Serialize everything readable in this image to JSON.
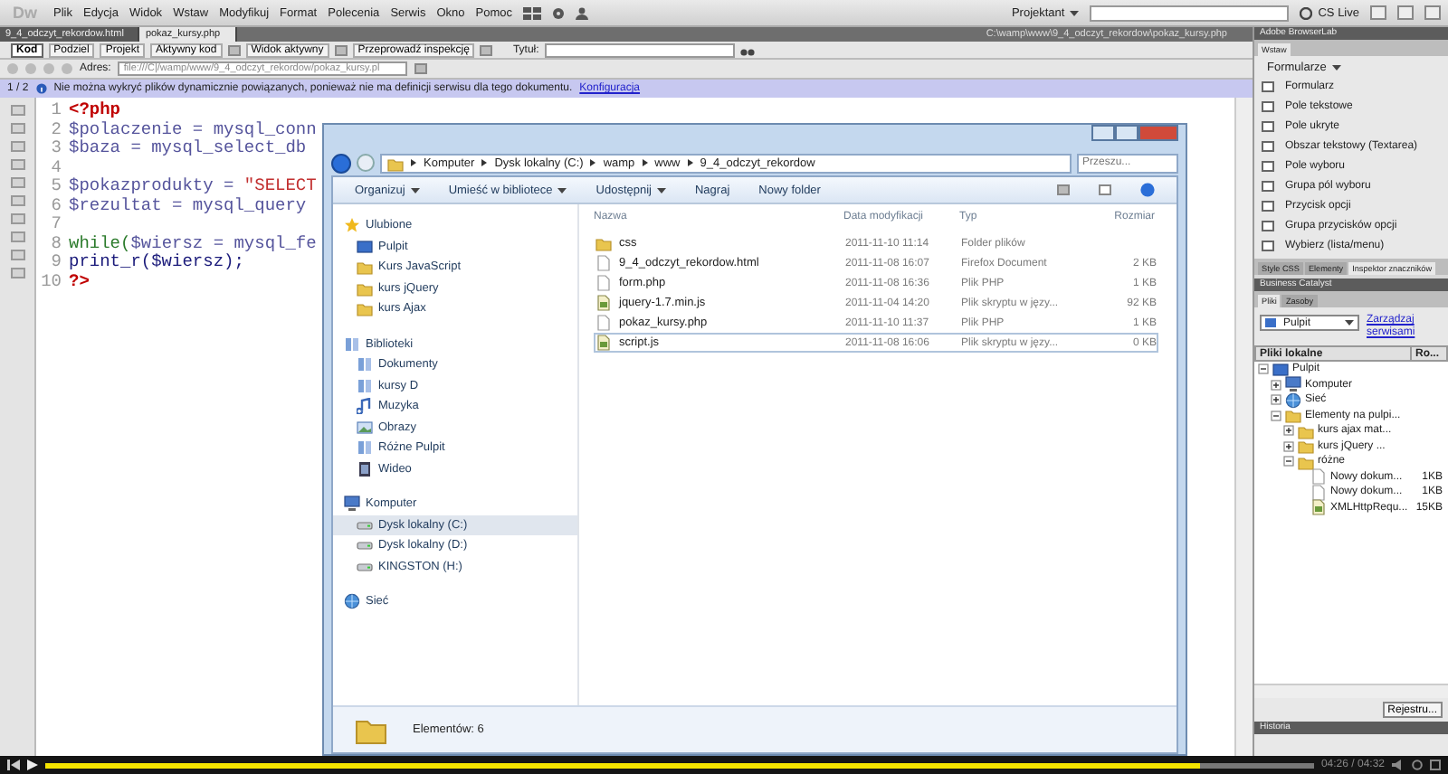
{
  "app": {
    "logo": "Dw",
    "menu": [
      "Plik",
      "Edycja",
      "Widok",
      "Wstaw",
      "Modyfikuj",
      "Format",
      "Polecenia",
      "Serwis",
      "Okno",
      "Pomoc"
    ],
    "workspace": "Projektant",
    "cs_live": "CS Live"
  },
  "document_tabs": [
    {
      "label": "9_4_odczyt_rekordow.html",
      "selected": false
    },
    {
      "label": "pokaz_kursy.php",
      "selected": true
    }
  ],
  "document_path": "C:\\wamp\\www\\9_4_odczyt_rekordow\\pokaz_kursy.php",
  "view_buttons": [
    {
      "label": "Kod",
      "selected": true
    },
    {
      "label": "Podziel",
      "selected": false
    },
    {
      "label": "Projekt",
      "selected": false
    }
  ],
  "toolbar_buttons": [
    "Aktywny kod",
    "Widok aktywny",
    "Przeprowadź inspekcję"
  ],
  "title_label": "Tytuł:",
  "address": {
    "label": "Adres:",
    "value": "file:///C|/wamp/www/9_4_odczyt_rekordow/pokaz_kursy.pl"
  },
  "info_bar": {
    "counter": "1 / 2",
    "message": "Nie można wykryć plików dynamicznie powiązanych, ponieważ nie ma definicji serwisu dla tego dokumentu.",
    "link": "Konfiguracja"
  },
  "code_lines": [
    {
      "number": "1",
      "tokens": [
        {
          "text": "<?php",
          "kind": "tag"
        }
      ]
    },
    {
      "number": "2",
      "tokens": [
        {
          "text": "$polaczenie = mysql_conn",
          "kind": "variable"
        }
      ]
    },
    {
      "number": "3",
      "tokens": [
        {
          "text": "$baza = mysql_select_db",
          "kind": "variable"
        }
      ]
    },
    {
      "number": "4"
    },
    {
      "number": "5",
      "tokens": [
        {
          "text": "$pokazprodukty = ",
          "kind": "variable"
        },
        {
          "text": "\"SELECT",
          "kind": "string"
        }
      ]
    },
    {
      "number": "6",
      "tokens": [
        {
          "text": "$rezultat = mysql_query",
          "kind": "variable"
        }
      ]
    },
    {
      "number": "7"
    },
    {
      "number": "8",
      "tokens": [
        {
          "text": "while(",
          "kind": "keyword"
        },
        {
          "text": "$wiersz = mysql_fe",
          "kind": "variable"
        }
      ]
    },
    {
      "number": "9",
      "tokens": [
        {
          "text": "print_r($wiersz);",
          "kind": "plain"
        }
      ]
    },
    {
      "number": "10",
      "tokens": [
        {
          "text": "?>",
          "kind": "tag"
        }
      ]
    }
  ],
  "explorer": {
    "breadcrumb": [
      "Komputer",
      "Dysk lokalny (C:)",
      "wamp",
      "www",
      "9_4_odczyt_rekordow"
    ],
    "search_placeholder": "Przeszu...",
    "toolbar": [
      {
        "label": "Organizuj",
        "dropdown": true
      },
      {
        "label": "Umieść w bibliotece",
        "dropdown": true
      },
      {
        "label": "Udostępnij",
        "dropdown": true
      },
      {
        "label": "Nagraj",
        "dropdown": false
      },
      {
        "label": "Nowy folder",
        "dropdown": false
      }
    ],
    "nav": [
      {
        "label": "Ulubione",
        "kind": "star",
        "selected": false,
        "items": [
          {
            "label": "Pulpit",
            "kind": "desktop",
            "selected": false
          },
          {
            "label": "Kurs JavaScript",
            "kind": "folder",
            "selected": false
          },
          {
            "label": "kurs jQuery",
            "kind": "folder",
            "selected": false
          },
          {
            "label": "kurs Ajax",
            "kind": "folder",
            "selected": false
          }
        ]
      },
      {
        "label": "Biblioteki",
        "kind": "library",
        "selected": false,
        "items": [
          {
            "label": "Dokumenty",
            "kind": "library",
            "selected": false
          },
          {
            "label": "kursy D",
            "kind": "library",
            "selected": false
          },
          {
            "label": "Muzyka",
            "kind": "music",
            "selected": false
          },
          {
            "label": "Obrazy",
            "kind": "picture",
            "selected": false
          },
          {
            "label": "Różne Pulpit",
            "kind": "library",
            "selected": false
          },
          {
            "label": "Wideo",
            "kind": "video",
            "selected": false
          }
        ]
      },
      {
        "label": "Komputer",
        "kind": "computer",
        "selected": false,
        "items": [
          {
            "label": "Dysk lokalny (C:)",
            "kind": "drive",
            "selected": true
          },
          {
            "label": "Dysk lokalny (D:)",
            "kind": "drive",
            "selected": false
          },
          {
            "label": "KINGSTON (H:)",
            "kind": "drive",
            "selected": false
          }
        ]
      },
      {
        "label": "Sieć",
        "kind": "network",
        "selected": false
      }
    ],
    "columns": [
      "Nazwa",
      "Data modyfikacji",
      "Typ",
      "Rozmiar"
    ],
    "files": [
      {
        "name": "css",
        "date": "2011-11-10 11:14",
        "type": "Folder plików",
        "kind": "folder",
        "focused": false
      },
      {
        "name": "9_4_odczyt_rekordow.html",
        "date": "2011-11-08 16:07",
        "type": "Firefox Document",
        "size": "2 KB",
        "kind": "file",
        "focused": false
      },
      {
        "name": "form.php",
        "date": "2011-11-08 16:36",
        "type": "Plik PHP",
        "size": "1 KB",
        "kind": "file",
        "focused": false
      },
      {
        "name": "jquery-1.7.min.js",
        "date": "2011-11-04 14:20",
        "type": "Plik skryptu w języ...",
        "size": "92 KB",
        "kind": "script",
        "focused": false
      },
      {
        "name": "pokaz_kursy.php",
        "date": "2011-11-10 11:37",
        "type": "Plik PHP",
        "size": "1 KB",
        "kind": "file",
        "focused": false
      },
      {
        "name": "script.js",
        "date": "2011-11-08 16:06",
        "type": "Plik skryptu w języ...",
        "size": "0 KB",
        "kind": "script",
        "focused": true
      }
    ],
    "status": "Elementów: 6"
  },
  "right_panel": {
    "browserlab": "Adobe BrowserLab",
    "insert_tab": "Wstaw",
    "category": "Formularze",
    "insert_items": [
      "Formularz",
      "Pole tekstowe",
      "Pole ukryte",
      "Obszar tekstowy (Textarea)",
      "Pole wyboru",
      "Grupa pól wyboru",
      "Przycisk opcji",
      "Grupa przycisków opcji",
      "Wybierz (lista/menu)"
    ],
    "panel_tabs": [
      {
        "label": "Style CSS",
        "selected": false
      },
      {
        "label": "Elementy",
        "selected": false
      },
      {
        "label": "Inspektor znaczników",
        "selected": true
      }
    ],
    "business_catalyst": "Business Catalyst",
    "files_tabs": [
      {
        "label": "Pliki",
        "selected": true
      },
      {
        "label": "Zasoby",
        "selected": false
      }
    ],
    "site_select": "Pulpit",
    "manage_link": "Zarządzaj serwisami",
    "columns": [
      "Pliki lokalne",
      "Ro..."
    ],
    "tree": [
      {
        "label": "Pulpit",
        "kind": "desktop",
        "expanded": true,
        "children": [
          {
            "label": "Komputer",
            "kind": "computer",
            "expanded": false
          },
          {
            "label": "Sieć",
            "kind": "network",
            "expanded": false
          },
          {
            "label": "Elementy na pulpi...",
            "kind": "folder",
            "expanded": true,
            "children": [
              {
                "label": "kurs ajax mat...",
                "kind": "folder",
                "expanded": false
              },
              {
                "label": "kurs jQuery ...",
                "kind": "folder",
                "expanded": false
              },
              {
                "label": "różne",
                "kind": "folder",
                "expanded": true,
                "children": [
                  {
                    "label": "Nowy dokum...",
                    "kind": "file",
                    "size": "1KB"
                  },
                  {
                    "label": "Nowy dokum...",
                    "kind": "file",
                    "size": "1KB"
                  },
                  {
                    "label": "XMLHttpRequ...",
                    "kind": "script",
                    "size": "15KB"
                  }
                ]
              }
            ]
          }
        ]
      }
    ],
    "register_button": "Rejestru...",
    "history": "Historia"
  },
  "player": {
    "level": 0.91,
    "time": "04:26 / 04:32"
  }
}
